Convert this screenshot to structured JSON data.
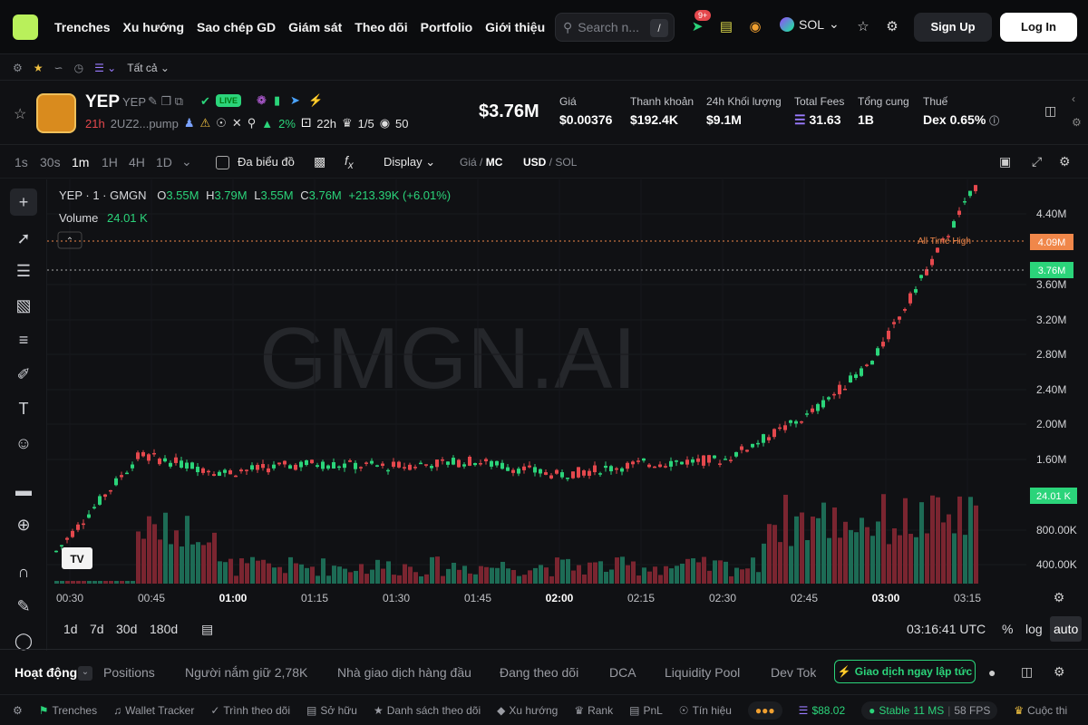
{
  "nav": {
    "items": [
      "Trenches",
      "Xu hướng",
      "Sao chép GD",
      "Giám sát",
      "Theo dõi",
      "Portfolio",
      "Giới thiệu"
    ],
    "search_placeholder": "Search n...",
    "search_shortcut": "/",
    "notif_badge": "9+",
    "chain": "SOL",
    "signup": "Sign Up",
    "login": "Log In"
  },
  "subbar": {
    "filter": "Tất cả"
  },
  "token": {
    "name": "YEP",
    "symbol": "YEP",
    "live": "LIVE",
    "age": "21h",
    "address": "2UZ2...pump",
    "holder_pct": "2%",
    "hours": "22h",
    "rank": "1/5",
    "views": "50",
    "market_cap": "$3.76M"
  },
  "stats": [
    {
      "label": "Giá",
      "value": "$0.00376"
    },
    {
      "label": "Thanh khoản",
      "value": "$192.4K"
    },
    {
      "label": "24h Khối lượng",
      "value": "$9.1M"
    },
    {
      "label": "Total Fees",
      "value": "31.63"
    },
    {
      "label": "Tổng cung",
      "value": "1B"
    },
    {
      "label": "Thuế",
      "value": "Dex 0.65%"
    }
  ],
  "toolbar": {
    "intervals": [
      "1s",
      "30s",
      "1m",
      "1H",
      "4H",
      "1D"
    ],
    "active_interval": "1m",
    "multi_chart": "Đa biểu đồ",
    "display": "Display",
    "price_label": "Giá",
    "mc_label": "MC",
    "usd": "USD",
    "sol": "SOL"
  },
  "legend": {
    "title": "YEP · 1 · GMGN",
    "o_label": "O",
    "o": "3.55M",
    "h_label": "H",
    "h": "3.79M",
    "l_label": "L",
    "l": "3.55M",
    "c_label": "C",
    "c": "3.76M",
    "change": "+213.39K (+6.01%)",
    "volume_label": "Volume",
    "volume": "24.01 K"
  },
  "watermark": "GMGN.AI",
  "ath_label": "All Time High",
  "ath_value": "4.09M",
  "current_value": "3.76M",
  "volume_value": "24.01 K",
  "yaxis_labels": [
    "4.40M",
    "3.60M",
    "3.20M",
    "2.80M",
    "2.40M",
    "2.00M",
    "1.60M",
    "800.00K",
    "400.00K"
  ],
  "xaxis_labels": [
    "00:30",
    "00:45",
    "01:00",
    "01:15",
    "01:30",
    "01:45",
    "02:00",
    "02:15",
    "02:30",
    "02:45",
    "03:00",
    "03:15"
  ],
  "xaxis_bold": [
    "01:00",
    "02:00",
    "03:00"
  ],
  "range": {
    "options": [
      "1d",
      "7d",
      "30d",
      "180d"
    ],
    "time": "03:16:41 UTC",
    "pct": "%",
    "log": "log",
    "auto": "auto"
  },
  "tabs": {
    "items": [
      "Hoạt động",
      "Positions",
      "Người nắm giữ 2,78K",
      "Nhà giao dịch hàng đầu",
      "Đang theo dõi",
      "DCA",
      "Liquidity Pool",
      "Dev Tok"
    ],
    "trade_button": "Giao dịch ngay lập tức"
  },
  "footer": {
    "items": [
      "Trenches",
      "Wallet Tracker",
      "Trình theo dõi",
      "Sở hữu",
      "Danh sách theo dõi",
      "Xu hướng",
      "Rank",
      "PnL",
      "Tín hiệu"
    ],
    "sol_price": "$88.02",
    "stable": "Stable",
    "ms": "11 MS",
    "fps": "58 FPS",
    "last": "Cuộc thi"
  },
  "colors": {
    "up": "#2bd47a",
    "down": "#e5484d",
    "ath": "#f0874a",
    "accent": "#2bd47a"
  },
  "chart_data": {
    "type": "candlestick",
    "x": [
      "00:30",
      "00:45",
      "01:00",
      "01:15",
      "01:30",
      "01:45",
      "02:00",
      "02:15",
      "02:30",
      "02:45",
      "03:00",
      "03:15"
    ],
    "close_mc": [
      0.55,
      1.65,
      1.45,
      1.55,
      1.52,
      1.58,
      1.42,
      1.55,
      1.6,
      2.1,
      2.9,
      3.76
    ],
    "ylim": [
      0.2,
      4.6
    ],
    "all_time_high": 4.09,
    "unit": "M USD"
  }
}
